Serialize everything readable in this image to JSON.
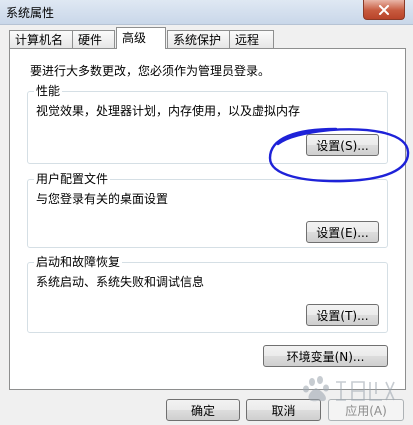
{
  "window": {
    "title": "系统属性"
  },
  "tabs": [
    {
      "label": "计算机名"
    },
    {
      "label": "硬件"
    },
    {
      "label": "高级"
    },
    {
      "label": "系统保护"
    },
    {
      "label": "远程"
    }
  ],
  "admin_note": "要进行大多数更改，您必须作为管理员登录。",
  "performance": {
    "title": "性能",
    "description": "视觉效果，处理器计划，内存使用，以及虚拟内存",
    "settings_label": "设置(S)..."
  },
  "user_profiles": {
    "title": "用户配置文件",
    "description": "与您登录有关的桌面设置",
    "settings_label": "设置(E)..."
  },
  "startup_recovery": {
    "title": "启动和故障恢复",
    "description": "系统启动、系统失败和调试信息",
    "settings_label": "设置(T)..."
  },
  "env_vars_label": "环境变量(N)...",
  "footer": {
    "ok_label": "确定",
    "cancel_label": "取消",
    "apply_label": "应用(A)"
  },
  "colors": {
    "highlight": "#1e22d8",
    "titlebar": "#c9d7e9",
    "close_button": "#c75a3e"
  },
  "icons": {
    "close": "close-icon",
    "watermark": "baidu-jingyan-logo"
  }
}
